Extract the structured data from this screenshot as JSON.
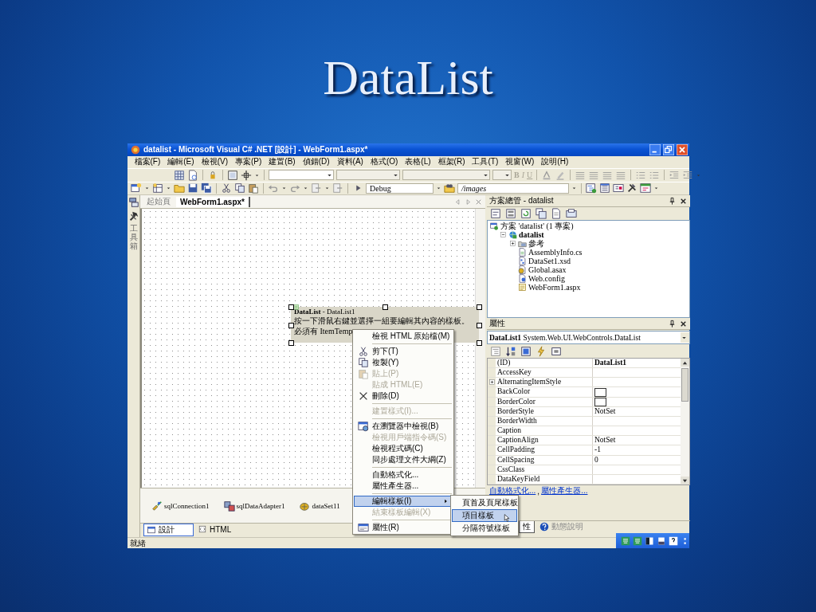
{
  "slide": {
    "title": "DataList"
  },
  "window": {
    "title": "datalist - Microsoft Visual C# .NET [設計] - WebForm1.aspx*"
  },
  "menu": [
    "檔案(F)",
    "編輯(E)",
    "檢視(V)",
    "專案(P)",
    "建置(B)",
    "偵錯(D)",
    "資料(A)",
    "格式(O)",
    "表格(L)",
    "框架(R)",
    "工具(T)",
    "視窗(W)",
    "說明(H)"
  ],
  "format_toolbar": {
    "buttons": [
      {
        "label": "B",
        "disabled": true
      },
      {
        "label": "I",
        "disabled": true
      },
      {
        "label": "U",
        "disabled": true
      }
    ]
  },
  "standard_toolbar": {
    "configuration": "Debug",
    "path": "/images"
  },
  "toolbox_strip": {
    "label": "工具箱"
  },
  "document_tabs": [
    {
      "label": "起始頁",
      "selected": false
    },
    {
      "label": "WebForm1.aspx*",
      "selected": true
    }
  ],
  "datalist_control": {
    "header": "**DataList** - DataList1",
    "lines": [
      "按一下滑鼠右鍵並選擇一組要編輯其內容的樣板。",
      "必須有 ItemTemp"
    ]
  },
  "component_tray": [
    {
      "label": "sqlConnection1",
      "kind": "connection"
    },
    {
      "label": "sqlDataAdapter1",
      "kind": "adapter"
    },
    {
      "label": "dataSet11",
      "kind": "dataset"
    }
  ],
  "view_tabs": [
    {
      "label": "設計",
      "kind": "design",
      "selected": true
    },
    {
      "label": "HTML",
      "kind": "html",
      "selected": false
    }
  ],
  "solution_explorer": {
    "title": "方案總管 - datalist",
    "tree": [
      {
        "label": "方案 'datalist' (1 專案)",
        "kind": "solution",
        "children": [
          {
            "label": "datalist",
            "kind": "project",
            "expanded": true,
            "children": [
              {
                "label": "參考",
                "kind": "folder",
                "expanded": false
              },
              {
                "label": "AssemblyInfo.cs",
                "kind": "cs"
              },
              {
                "label": "DataSet1.xsd",
                "kind": "xsd"
              },
              {
                "label": "Global.asax",
                "kind": "asax"
              },
              {
                "label": "Web.config",
                "kind": "config"
              },
              {
                "label": "WebForm1.aspx",
                "kind": "aspx"
              }
            ]
          }
        ]
      }
    ]
  },
  "properties": {
    "title": "屬性",
    "object": "**DataList1** System.Web.UI.WebControls.DataList",
    "rows": [
      {
        "name": "(ID)",
        "kind": "text",
        "value": "DataList1",
        "modified": true
      },
      {
        "name": "AccessKey",
        "kind": "text"
      },
      {
        "name": "AlternatingItemStyle",
        "kind": "group",
        "expanded": false
      },
      {
        "name": "BackColor",
        "kind": "color"
      },
      {
        "name": "BorderColor",
        "kind": "color"
      },
      {
        "name": "BorderStyle",
        "kind": "text",
        "value": "NotSet",
        "modified": false
      },
      {
        "name": "BorderWidth",
        "kind": "text"
      },
      {
        "name": "Caption",
        "kind": "text"
      },
      {
        "name": "CaptionAlign",
        "kind": "text",
        "value": "NotSet",
        "modified": false
      },
      {
        "name": "CellPadding",
        "kind": "text",
        "value": "-1",
        "modified": false
      },
      {
        "name": "CellSpacing",
        "kind": "text",
        "value": "0",
        "modified": false
      },
      {
        "name": "CssClass",
        "kind": "text"
      },
      {
        "name": "DataKeyField",
        "kind": "text"
      }
    ],
    "links": [
      "自動格式化...",
      "屬性產生器..."
    ],
    "link_separator": ",",
    "tabs": [
      {
        "label": "性",
        "kind": "properties",
        "selected": true
      },
      {
        "label": "動態說明",
        "kind": "help",
        "selected": false
      }
    ]
  },
  "context_menu": [
    {
      "kind": "item",
      "label": "檢視 HTML 原始檔(M)",
      "disabled": false,
      "selected": false,
      "submenu": false
    },
    {
      "kind": "separator"
    },
    {
      "kind": "item",
      "label": "剪下(T)",
      "disabled": false,
      "selected": false,
      "submenu": false
    },
    {
      "kind": "item",
      "label": "複製(Y)",
      "disabled": false,
      "selected": false,
      "submenu": false
    },
    {
      "kind": "item",
      "label": "貼上(P)",
      "disabled": true,
      "selected": false,
      "submenu": false
    },
    {
      "kind": "item",
      "label": "貼成 HTML(E)",
      "disabled": true,
      "selected": false,
      "submenu": false
    },
    {
      "kind": "item",
      "label": "刪除(D)",
      "disabled": false,
      "selected": false,
      "submenu": false
    },
    {
      "kind": "separator"
    },
    {
      "kind": "item",
      "label": "建置樣式(I)...",
      "disabled": true,
      "selected": false,
      "submenu": false
    },
    {
      "kind": "separator"
    },
    {
      "kind": "item",
      "label": "在瀏覽器中檢視(B)",
      "disabled": false,
      "selected": false,
      "submenu": false
    },
    {
      "kind": "item",
      "label": "檢視用戶端指令碼(S)",
      "disabled": true,
      "selected": false,
      "submenu": false
    },
    {
      "kind": "item",
      "label": "檢視程式碼(C)",
      "disabled": false,
      "selected": false,
      "submenu": false
    },
    {
      "kind": "item",
      "label": "同步處理文件大綱(Z)",
      "disabled": false,
      "selected": false,
      "submenu": false
    },
    {
      "kind": "separator"
    },
    {
      "kind": "item",
      "label": "自動格式化...",
      "disabled": false,
      "selected": false,
      "submenu": false
    },
    {
      "kind": "item",
      "label": "屬性產生器...",
      "disabled": false,
      "selected": false,
      "submenu": false
    },
    {
      "kind": "separator"
    },
    {
      "kind": "item",
      "label": "編輯樣板(I)",
      "disabled": false,
      "selected": true,
      "submenu": true
    },
    {
      "kind": "item",
      "label": "結束樣板編輯(X)",
      "disabled": true,
      "selected": false,
      "submenu": false
    },
    {
      "kind": "separator"
    },
    {
      "kind": "item",
      "label": "屬性(R)",
      "disabled": false,
      "selected": false,
      "submenu": false
    }
  ],
  "submenu": [
    {
      "label": "頁首及頁尾樣板",
      "selected": false
    },
    {
      "label": "項目樣板",
      "selected": true
    },
    {
      "label": "分隔符號樣板",
      "selected": false
    }
  ],
  "status_bar": {
    "text": "就緒"
  }
}
